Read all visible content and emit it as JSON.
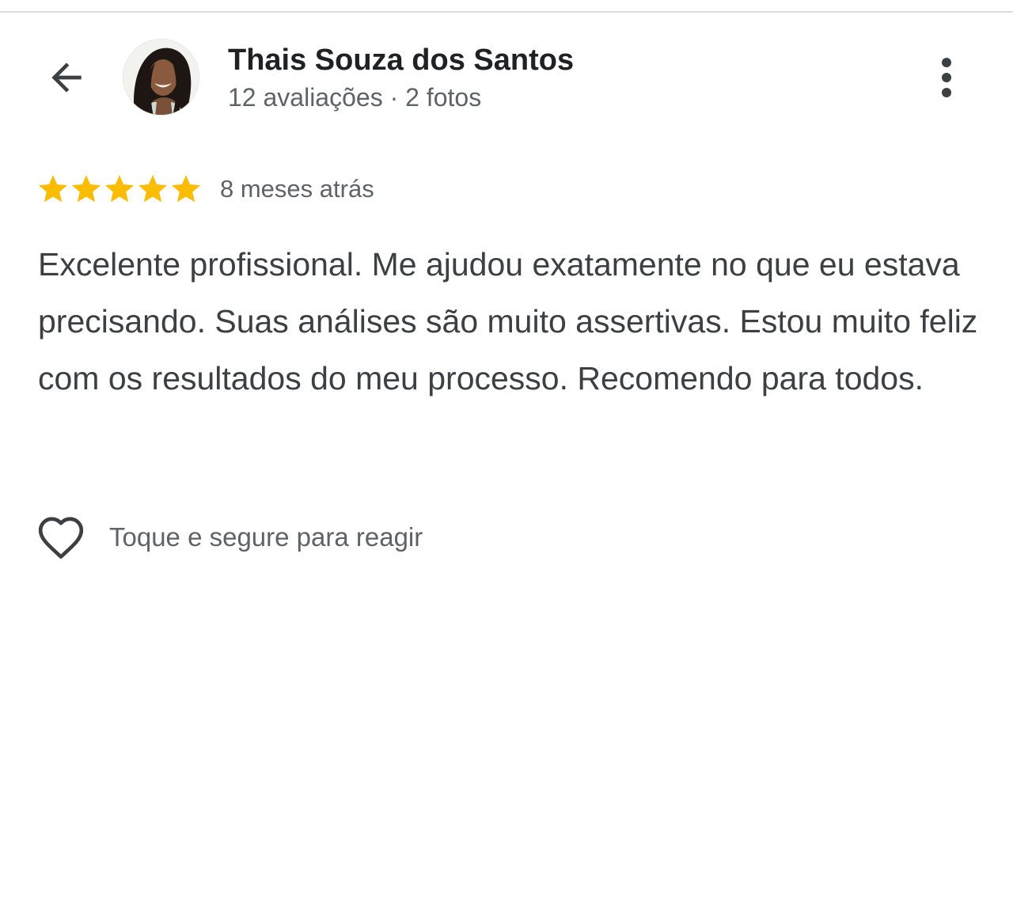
{
  "header": {
    "back_icon": "arrow-back-icon",
    "more_icon": "more-vert-icon"
  },
  "reviewer": {
    "name": "Thais Souza dos Santos",
    "meta": "12 avaliações · 2 fotos"
  },
  "review": {
    "rating": 5,
    "max_rating": 5,
    "star_color": "#fbbc04",
    "date": "8 meses atrás",
    "text": "Excelente profissional. Me ajudou exatamente no que eu estava precisando. Suas análises são muito assertivas. Estou muito feliz com os resultados do meu processo. Recomendo para todos."
  },
  "reactions": {
    "icon": "heart-outline-icon",
    "label": "Toque e segure para reagir"
  }
}
